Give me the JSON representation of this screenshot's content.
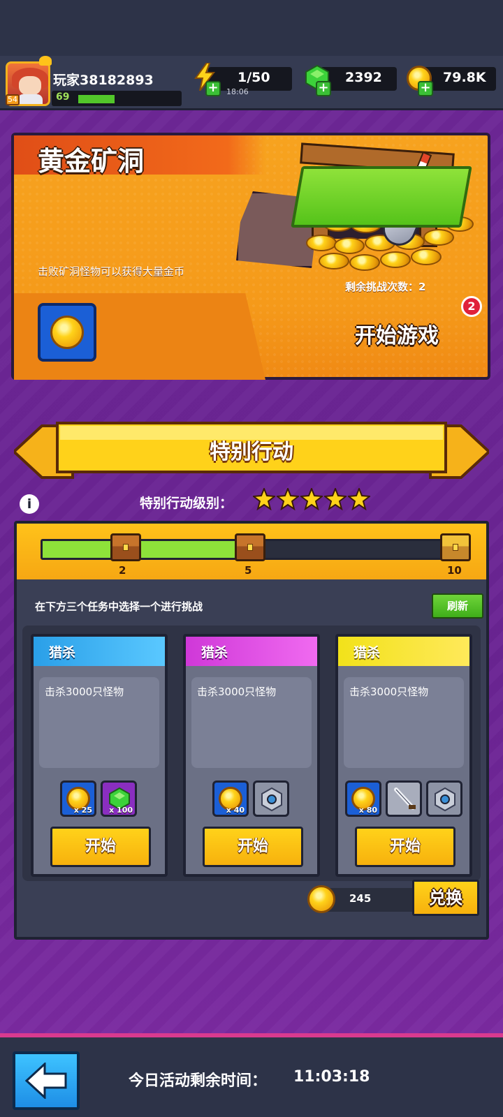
{
  "header": {
    "player_name": "玩家38182893",
    "player_level": "69",
    "avatar_level": "54",
    "energy": "1/50",
    "energy_timer": "18:06",
    "gems": "2392",
    "gold": "79.8K"
  },
  "event": {
    "title": "黄金矿洞",
    "description": "击败矿洞怪物可以获得大量金币",
    "remaining_label": "剩余挑战次数：2",
    "start_label": "开始游戏",
    "badge_count": "2"
  },
  "special": {
    "banner_title": "特别行动",
    "level_label": "特别行动级别：",
    "stars": 5,
    "progress_fraction": 0.5,
    "milestones": [
      "2",
      "5",
      "10"
    ],
    "instruction": "在下方三个任务中选择一个进行挑战",
    "refresh_label": "刷新",
    "tasks": [
      {
        "type": "猎杀",
        "desc": "击杀3000只怪物",
        "rewards": [
          {
            "icon": "gold-coin-icon",
            "qty": "x 25"
          },
          {
            "icon": "green-gem-icon",
            "qty": "x 100"
          }
        ],
        "start": "开始",
        "color": "#29a8f0"
      },
      {
        "type": "猎杀",
        "desc": "击杀3000只怪物",
        "rewards": [
          {
            "icon": "gold-coin-icon",
            "qty": "x 40"
          },
          {
            "icon": "robot-part-icon",
            "qty": ""
          }
        ],
        "start": "开始",
        "color": "#d63ed6"
      },
      {
        "type": "猎杀",
        "desc": "击杀3000只怪物",
        "rewards": [
          {
            "icon": "gold-coin-icon",
            "qty": "x 80"
          },
          {
            "icon": "sword-icon",
            "qty": ""
          },
          {
            "icon": "robot-part-icon",
            "qty": ""
          }
        ],
        "start": "开始",
        "color": "#f2e21a"
      }
    ],
    "tokens": "245",
    "exchange_label": "兑换"
  },
  "footer": {
    "time_label": "今日活动剩余时间：",
    "time_value": "11:03:18"
  }
}
